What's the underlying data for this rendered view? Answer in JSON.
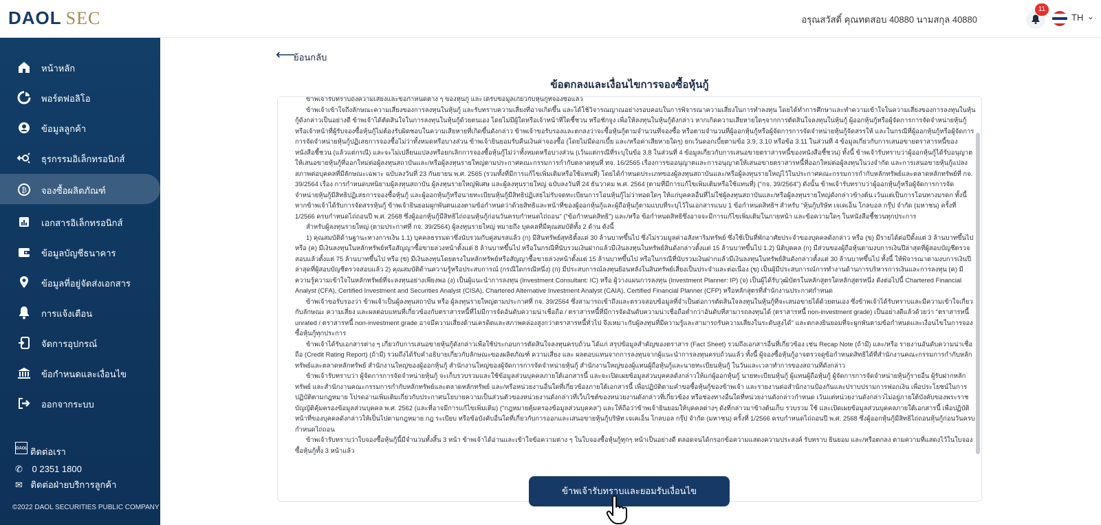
{
  "header": {
    "logo_primary": "DAOL",
    "logo_secondary": "SEC",
    "greeting": "อรุณสวัสดิ์ คุณทดสอบ 40880 นามสกุล 40880",
    "notification_count": "11",
    "language": "TH",
    "icons": [
      "bell-icon",
      "thai-flag-icon",
      "chevron-down-icon"
    ]
  },
  "sidebar": {
    "items": [
      {
        "label": "หน้าหลัก",
        "icon": "home-icon"
      },
      {
        "label": "พอร์ตฟอลิโอ",
        "icon": "portfolio-icon"
      },
      {
        "label": "ข้อมูลลูกค้า",
        "icon": "user-icon"
      },
      {
        "label": "ธุรกรรมอิเล็กทรอนิกส์",
        "icon": "transaction-icon"
      },
      {
        "label": "จองซื้อผลิตภัณฑ์",
        "icon": "bitcoin-icon",
        "active": true
      },
      {
        "label": "เอกสารอิเล็กทรอนิกส์",
        "icon": "document-chart-icon"
      },
      {
        "label": "ข้อมูลบัญชีธนาคาร",
        "icon": "wallet-icon"
      },
      {
        "label": "ข้อมูลที่อยู่จัดส่งเอกสาร",
        "icon": "location-icon"
      },
      {
        "label": "การแจ้งเตือน",
        "icon": "bell-icon"
      },
      {
        "label": "จัดการอุปกรณ์",
        "icon": "device-icon"
      },
      {
        "label": "ข้อกำหนดและเงื่อนไข",
        "icon": "bank-icon"
      },
      {
        "label": "ออกจากระบบ",
        "icon": "logout-icon"
      }
    ],
    "contact_title": "ติดต่อเรา",
    "contact_logo": "DAOL",
    "phone": "0 2351 1800",
    "contact_support": "ติดต่อฝ่ายบริการลูกค้า",
    "copyright": "©2022 DAOL SECURITIES PUBLIC COMPANY"
  },
  "main": {
    "back_label": "ย้อนกลับ",
    "title": "ข้อตกลงและเงื่อนไขการจองซื้อหุ้นกู้",
    "accept_button": "ข้าพเจ้ารับทราบและยอมรับเงื่อนไข",
    "paragraphs": [
      "ข้าพเจ้ารับทราบถึงความเสี่ยงและข้อกำหนดต่าง ๆ ของหุ้นกู้ และได้รับข้อมูลเกี่ยวกับหุ้นกู้ที่จองซื้อแล้ว",
      "ข้าพเจ้าเข้าใจถึงลักษณะความเสี่ยงของการลงทุนในหุ้นกู้ และรับทราบความเสี่ยงที่อาจเกิดขึ้น และได้ใช้วิจารณญาณอย่างรอบคอบในการพิจารณาความเสี่ยงในการทำลงทุน โดยได้ทำการศึกษาและทำความเข้าใจในความเสี่ยงของการลงทุนในหุ้นกู้ดังกล่าวเป็นอย่างดี ข้าพเจ้าได้ตัดสินใจในการลงทุนในหุ้นกู้ด้วยตนเอง โดยไม่มีผู้ใดหรือเจ้าหน้าที่ใดชี้ชวน หรือชักจูง เพื่อให้ลงทุนในหุ้นกู้ดังกล่าว หากเกิดความเสียหายใดๆจากการตัดสินใจลงทุนในหุ้นกู้ ผู้ออกหุ้นกู้หรือผู้จัดการการจัดจำหน่ายหุ้นกู้หรือเจ้าหน้าที่ผู้รับจองซื้อหุ้นกู้ไม่ต้องรับผิดชอบในความเสียหายที่เกิดขึ้นดังกล่าว ข้าพเจ้าขอรับรองและตกลงว่าจะซื้อหุ้นกู้ตามจำนวนที่จองซื้อ หรือตามจำนวนที่ผู้ออกหุ้นกู้หรือผู้จัดการการจัดจำหน่ายหุ้นกู้จัดสรรให้ และในกรณีที่ผู้ออกหุ้นกู้หรือผู้จัดการการจัดจำหน่ายหุ้นกู้ปฏิเสธการจองซื้อไม่ว่าทั้งหมดหรือบางส่วน ข้าพเจ้ายินยอมรับคืนเงินค่าจองซื้อ (โดยไม่มีดอกเบี้ย และ/หรือค่าเสียหายใดๆ) ยกเว้นดอกเบี้ยตามข้อ 3.9, 3.10 หรือข้อ 3.11 ในส่วนที่ 4 ข้อมูลเกี่ยวกับการเสนอขายตราสารหนี้ของหนังสือชี้ชวน (แล้วแต่กรณี) และจะไม่เปลี่ยนแปลงหรือยกเลิกการจองซื้อหุ้นกู้ไม่ว่าทั้งหมดหรือบางส่วน (เว้นแต่กรณีที่ระบุในข้อ 3.8 ในส่วนที่ 4 ข้อมูลเกี่ยวกับการเสนอขายตราสารหนี้ของหนังสือชี้ชวน) ทั้งนี้ ข้าพเจ้ารับทราบว่าผู้ออกหุ้นกู้ได้รับอนุญาตให้เสนอขายหุ้นกู้ที่ออกใหม่ต่อผู้ลงทุนสถาบันและ/หรือผู้ลงทุนรายใหญ่ตามประกาศคณะกรรมการกำกับตลาดทุนที่ ทจ. 16/2565 เรื่องการขออนุญาตและการอนุญาตให้เสนอขายตราสารหนี้ที่ออกใหม่ต่อผู้ลงทุนในวงจำกัด และการเสนอขายหุ้นกู้แปลงสภาพต่อบุคคลที่มีลักษณะเฉพาะ ฉบับลงวันที่ 23 กันยายน พ.ศ. 2565 (รวมทั้งที่มีการแก้ไขเพิ่มเติมหรือใช้แทนที่) โดยได้กำหนดประเภทของผู้ลงทุนสถาบันและ/หรือผู้ลงทุนรายใหญ่ไว้ในประกาศคณะกรรมการกำกับหลักทรัพย์และตลาดหลักทรัพย์ที่ กจ. 39/2564 เรื่อง การกำหนดบทนิยามผู้ลงทุนสถาบัน ผู้ลงทุนรายใหญ่พิเศษ และผู้ลงทุนรายใหญ่ ฉบับลงวันที่ 24 ธันวาคม พ.ศ. 2564 (ตามที่มีการแก้ไขเพิ่มเติมหรือใช้แทนที่) (\"กจ. 39/2564\") ดังนั้น ข้าพเจ้ารับทราบว่าผู้ออกหุ้นกู้หรือผู้จัดการการจัดจำหน่ายหุ้นกู้มีสิทธิปฏิเสธการจองซื้อหุ้นกู้ และผู้ออกหุ้นกู้หรือนายทะเบียนหุ้นกู้มีสิทธิปฏิเสธไม่รับจดทะเบียนการโอนหุ้นกู้ไม่ว่าทอดใดๆ ให้แก่บุคคลอื่นที่ไม่ใช่ผู้ลงทุนสถาบันและ/หรือผู้ลงทุนรายใหญ่ดังกล่าวข้างต้น เว้นแต่เป็นการโอนทางมรดก ทั้งนี้ หากข้าพเจ้าได้รับการจัดสรรหุ้นกู้ ข้าพเจ้ายินยอมผูกพันตนเองตามข้อกำหนดว่าด้วยสิทธิและหน้าที่ของผู้ออกหุ้นกู้และผู้ถือหุ้นกู้ตามแบบที่ระบุไว้ในเอกสารแนบ 1 ข้อกำหนดสิทธิฯ สำหรับ \"หุ้นกู้บริษัท เจเคเอ็น โกลบอล กรุ๊ป จำกัด (มหาชน) ครั้งที่ 1/2566 ครบกำหนดไถ่ถอนปี พ.ศ. 2568 ซึ่งผู้ออกหุ้นกู้มีสิทธิไถ่ถอนหุ้นกู้ก่อนวันครบกำหนดไถ่ถอน\" (\"ข้อกำหนดสิทธิ\") และ/หรือ ข้อกำหนดสิทธิซึ่งอาจจะมีการแก้ไขเพิ่มเติมในภายหน้า และข้อความใดๆ ในหนังสือชี้ชวนทุกประการ",
      "สำหรับผู้ลงทุนรายใหญ่ (ตามประกาศที่ กจ. 39/2564) ผู้ลงทุนรายใหญ่ หมายถึง บุคคลที่มีคุณสมบัติทั้ง 2 ด้าน ดังนี้",
      "1) คุณสมบัติด้านฐานะทางการเงิน 1.1) บุคคลธรรมดาซึ่งนับรวมกับคู่สมรสแล้ว (ก) มีสินทรัพย์สุทธิตั้งแต่ 30 ล้านบาทขึ้นไป ซึ่งไม่รวมมูลค่าอสังหาริมทรัพย์ ซึ่งใช้เป็นที่พักอาศัยประจำของบุคคลดังกล่าว หรือ (ข) มีรายได้ต่อปีตั้งแต่ 3 ล้านบาทขึ้นไป หรือ (ค) มีเงินลงทุนในหลักทรัพย์หรือสัญญาซื้อขายล่วงหน้าตั้งแต่ 8 ล้านบาทขึ้นไป หรือในกรณีที่นับรวมเงินฝากแล้วมีเงินลงทุนในทรัพย์สินดังกล่าวตั้งแต่ 15 ล้านบาทขึ้นไป 1.2) นิติบุคคล (ก) มีส่วนของผู้ถือหุ้นตามงบการเงินปีล่าสุดที่ผู้สอบบัญชีตรวจสอบแล้วตั้งแต่ 75 ล้านบาทขึ้นไป หรือ (ข) มีเงินลงทุนโดยตรงในหลักทรัพย์หรือสัญญาซื้อขายล่วงหน้าตั้งแต่ 15 ล้านบาทขึ้นไป หรือในกรณีที่นับรวมเงินฝากแล้วมีเงินลงทุนในทรัพย์สินดังกล่าวตั้งแต่ 30 ล้านบาทขึ้นไป ทั้งนี้ ให้พิจารณาตามงบการเงินปีล่าสุดที่ผู้สอบบัญชีตรวจสอบแล้ว 2) คุณสมบัติด้านความรู้หรือประสบการณ์ (กรณีใดกรณีหนึ่ง) (ก) มีประสบการณ์ลงทุนย้อนหลังในสินทรัพย์เสี่ยงเป็นประจำและต่อเนื่อง (ข) เป็นผู้มีประสบการณ์การทำงานด้านการบริหารการเงินและการลงทุน (ค) มีความรู้ความเข้าใจในหลักทรัพย์ที่จะลงทุนอย่างเพียงพอ (ง) เป็นผู้แนะนำการลงทุน (Investment Consultant: IC) หรือ ผู้วางแผนการลงทุน (Investment Planner: IP) (จ) เป็นผู้ได้รับวุฒิบัตรในหลักสูตรใดหลักสูตรหนึ่ง ดังต่อไปนี้ Chartered Financial Analyst (CFA), Certified Investment and Securities Analyst (CISA), Chartered Alternative Investment Analyst (CAIA), Certified Financial Planner (CFP) หรือหลักสูตรที่สำนักงานประกาศกำหนด",
      "ข้าพเจ้าขอรับรองว่า ข้าพเจ้าเป็นผู้ลงทุนสถาบัน หรือ ผู้ลงทุนรายใหญ่ตามประกาศที่ กจ. 39/2564 ซึ่งสามารถเข้าถึงและตรวจสอบข้อมูลที่จำเป็นต่อการตัดสินใจลงทุนในหุ้นกู้ที่จะเสนอขายได้ด้วยตนเอง ซึ่งข้าพเจ้าได้รับทราบและมีความเข้าใจเกี่ยวกับลักษณะ ความเสี่ยง และผลตอบแทนที่เกี่ยวข้องกับตราสารหนี้ที่ไม่มีการจัดอันดับความน่าเชื่อถือ / ตราสารหนี้ที่มีการจัดอันดับความน่าเชื่อถือต่ำกว่าอันดับที่สามารถลงทุนได้ (ตราสารหนี้ non-investment grade) เป็นอย่างดีแล้วด้วยว่า \"ตราสารหนี้ unrated / ตราสารหนี้ non-investment grade อาจมีความเสี่ยงด้านเครดิตและสภาพคล่องสูงกว่าตราสารหนี้ทั่วไป จึงเหมาะกับผู้ลงทุนที่มีความรู้และสามารถรับความเสี่ยงในระดับสูงได้\" และตกลงยินยอมที่จะผูกพันตามข้อกำหนดและเงื่อนไขในการจองซื้อหุ้นกู้ทุกประการ",
      "ข้าพเจ้าได้รับเอกสารต่าง ๆ เกี่ยวกับการเสนอขายหุ้นกู้ดังกล่าวเพื่อใช้ประกอบการตัดสินใจลงทุนครบถ้วน ได้แก่ สรุปข้อมูลสำคัญของตราสาร (Fact Sheet) รวมถึงเอกสารอื่นที่เกี่ยวข้อง เช่น Recap Note (ถ้ามี) และ/หรือ รายงานอันดับความน่าเชื่อถือ (Credit Rating Report) (ถ้ามี) รวมถึงได้รับคำอธิบายเกี่ยวกับลักษณะของผลิตภัณฑ์ ความเสี่ยง และ ผลตอบแทนจากการลงทุนจากผู้แนะนำการลงทุนครบถ้วนแล้ว ทั้งนี้ ผู้จองซื้อหุ้นกู้อาจตรวจดูข้อกำหนดสิทธิได้ที่สำนักงานคณะกรรมการกำกับหลักทรัพย์และตลาดหลักทรัพย์ สำนักงานใหญ่ของผู้ออกหุ้นกู้ สำนักงานใหญ่ของผู้จัดการการจัดจำหน่ายหุ้นกู้ สำนักงานใหญ่ของผู้แทนผู้ถือหุ้นกู้และนายทะเบียนหุ้นกู้ ในวันและเวลาทำการของสถานที่ดังกล่าว",
      "ข้าพเจ้ารับทราบว่า ผู้จัดการการจัดจำหน่ายหุ้นกู้ จะเก็บรวบรวมและใช้ข้อมูลส่วนบุคคลภายใต้เอกสารนี้ และจะเปิดเผยข้อมูลส่วนบุคคลดังกล่าวให้แก่ผู้ออกหุ้นกู้ นายทะเบียนหุ้นกู้ ผู้แทนผู้ถือหุ้นกู้ ผู้จัดการการจัดจำหน่ายหุ้นกู้รายอื่น ผู้รับฝากหลักทรัพย์ และสำนักงานคณะกรรมการกำกับหลักทรัพย์และตลาดหลักทรัพย์ และ/หรือหน่วยงานอื่นใดที่เกี่ยวข้องภายใต้เอกสารนี้ เพื่อปฏิบัติตามคำขอซื้อหุ้นกู้ของข้าพเจ้า และรายงานต่อสำนักงานป้องกันและปราบปรามการฟอกเงิน เพื่อประโยชน์ในการปฏิบัติตามกฎหมาย โปรดอ่านเพิ่มเติมเกี่ยวกับประกาศนโยบายความเป็นส่วนตัวของหน่วยงานดังกล่าวที่เว็บไซต์ของหน่วยงานดังกล่าวที่เกี่ยวข้อง หรือช่องทางอื่นใดที่หน่วยงานดังกล่าวกำหนด เว้นแต่หน่วยงานดังกล่าวไม่อยู่ภายใต้บังคับของพระราชบัญญัติคุ้มครองข้อมูลส่วนบุคคล พ.ศ. 2562 (และที่อาจมีการแก้ไขเพิ่มเติม) (\"กฎหมายคุ้มครองข้อมูลส่วนบุคคล\") และให้ถือว่าข้าพเจ้ายินยอมให้บุคคลต่างๆ ดังที่กล่าวมาข้างต้นเก็บ รวบรวม ใช้ และเปิดเผยข้อมูลส่วนบุคคลภายใต้เอกสารนี้ เพื่อปฏิบัติหน้าที่ของบุคคลดังกล่าวให้เป็นไปตามกฎหมาย กฎ ระเบียบ หรือข้อบังคับอื่นใดที่เกี่ยวกับการออกและเสนอขายหุ้นกู้บริษัท เจเคเอ็น โกลบอล กรุ๊ป จำกัด (มหาชน) ครั้งที่ 1/2566 ครบกำหนดไถ่ถอนปี พ.ศ. 2568 ซึ่งผู้ออกหุ้นกู้มีสิทธิไถ่ถอนหุ้นกู้ก่อนวันครบกำหนดไถ่ถอน",
      "ข้าพเจ้ารับทราบว่าใบจองซื้อหุ้นกู้นี้มีจำนวนทั้งสิ้น 3 หน้า ข้าพเจ้าได้อ่านและเข้าใจข้อความต่าง ๆ ในใบจองซื้อหุ้นกู้ทุกๆ หน้าเป็นอย่างดี ตลอดจนได้กรอกข้อความแสดงความประสงค์ รับทราบ ยินยอม และ/หรือตกลง ตามความที่แสดงไว้ในใบจองซื้อหุ้นกู้ทั้ง 3 หน้าแล้ว"
    ]
  }
}
